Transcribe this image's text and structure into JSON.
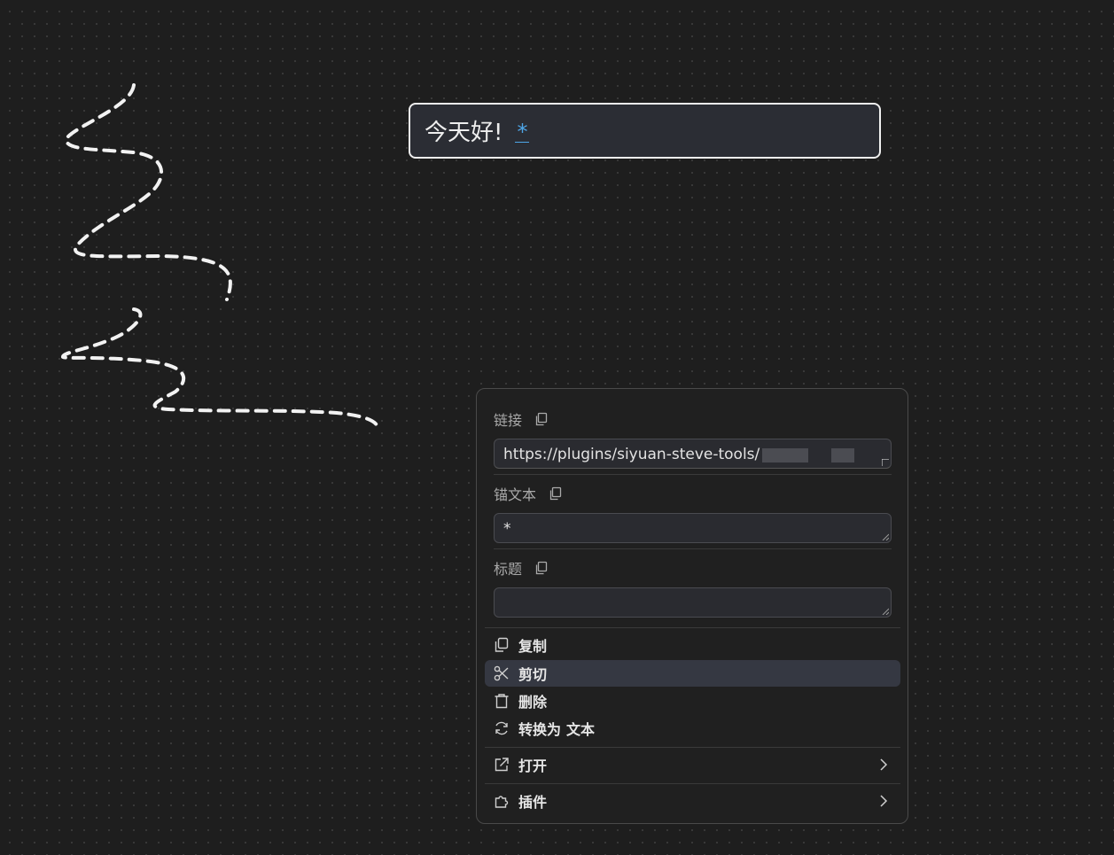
{
  "canvas": {
    "textbox_text": "今天好!",
    "textbox_star": "*"
  },
  "menu": {
    "link_label": "链接",
    "link_value": "https://plugins/siyuan-steve-tools/",
    "anchor_label": "锚文本",
    "anchor_value": "*",
    "title_label": "标题",
    "title_value": "",
    "items": {
      "copy": "复制",
      "cut": "剪切",
      "delete": "删除",
      "convert_prefix": "转换为",
      "convert_target": "文本",
      "open": "打开",
      "plugins": "插件"
    }
  },
  "colors": {
    "background": "#1e1e1e",
    "menu_bg": "#202020",
    "active_item": "#353842",
    "accent": "#4ea6e8"
  }
}
